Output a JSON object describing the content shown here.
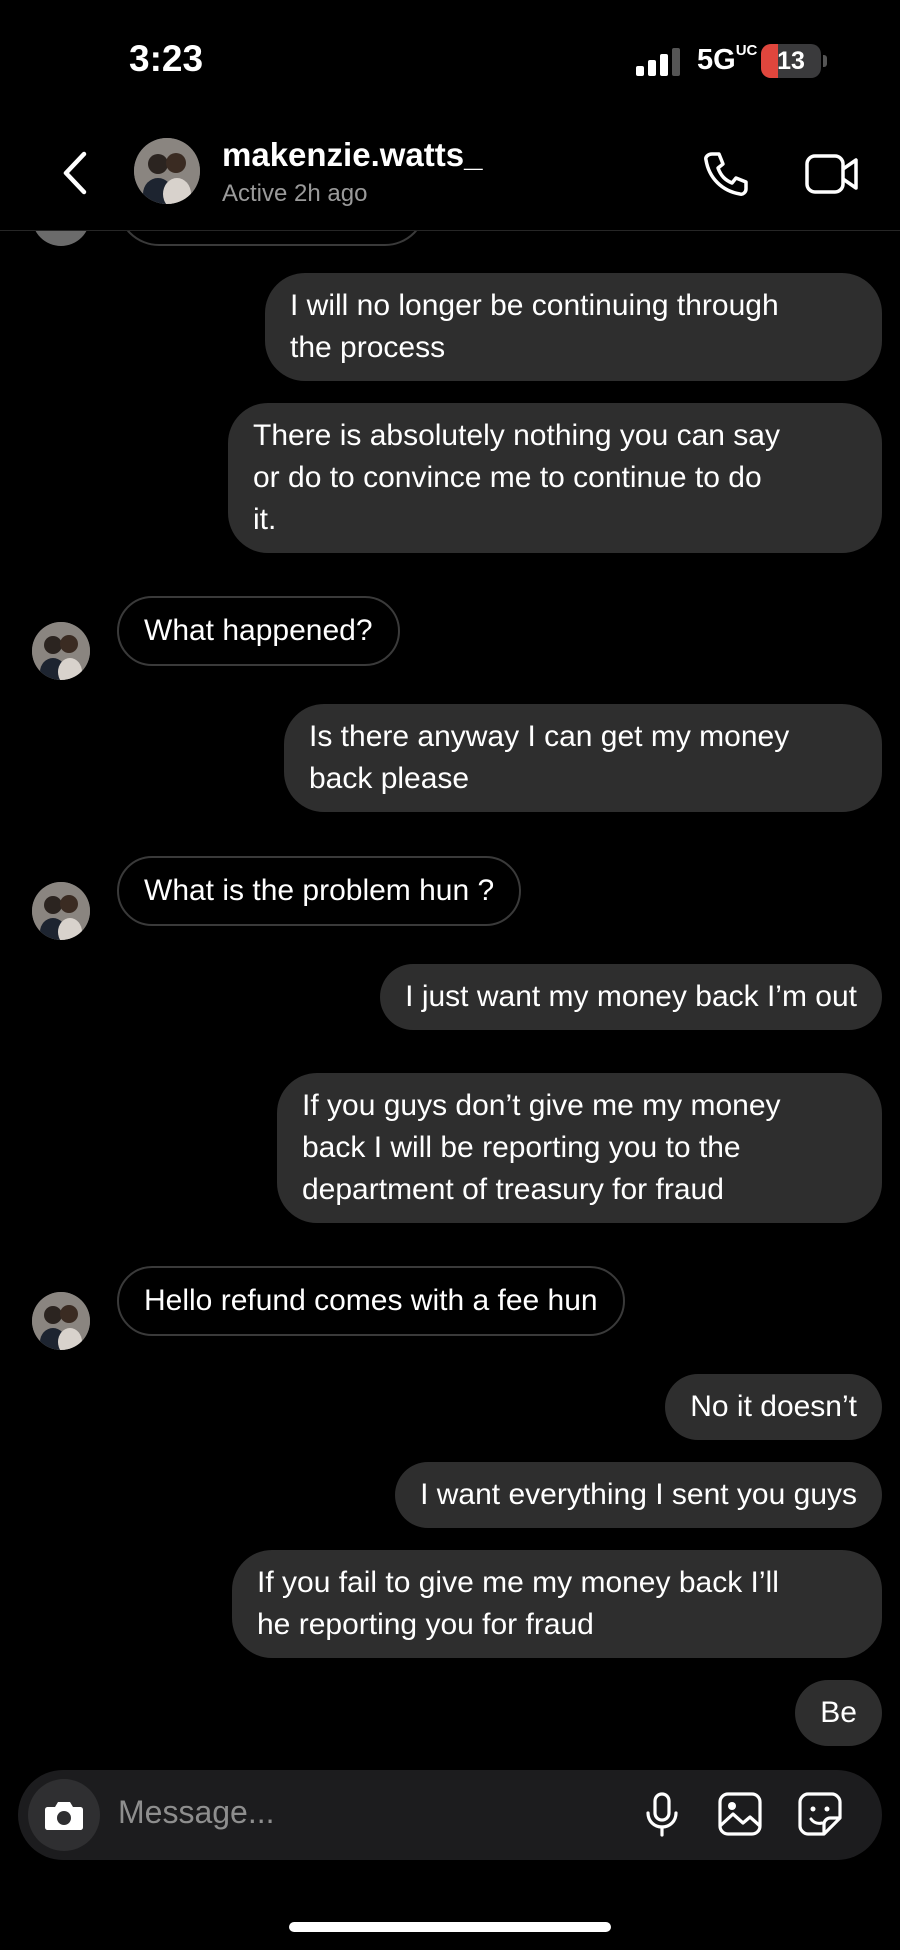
{
  "status_bar": {
    "time": "3:23",
    "network": "5G",
    "network_sup": "UC",
    "battery": "13",
    "battery_level": 0.13
  },
  "header": {
    "username": "makenzie.watts_",
    "status": "Active 2h ago"
  },
  "messages": [
    {
      "from": "me",
      "text": "I will no longer be continuing through\nthe process"
    },
    {
      "from": "me",
      "text": "There is absolutely nothing you can say\nor do to convince me to continue to do\nit."
    },
    {
      "from": "them",
      "text": "What happened?"
    },
    {
      "from": "me",
      "text": "Is there anyway I can get my money\nback please"
    },
    {
      "from": "them",
      "text": "What is the problem hun ?"
    },
    {
      "from": "me",
      "text": "I just want my money back I’m out"
    },
    {
      "from": "me",
      "text": "If you guys don’t give me my money\nback I will be reporting you to the\ndepartment of treasury for fraud"
    },
    {
      "from": "them",
      "text": "Hello refund comes with a fee hun"
    },
    {
      "from": "me",
      "text": "No it doesn’t"
    },
    {
      "from": "me",
      "text": "I want everything I sent you guys"
    },
    {
      "from": "me",
      "text": "If you fail to give me my money back I’ll\nhe reporting you for fraud"
    },
    {
      "from": "me",
      "text": "Be"
    }
  ],
  "composer": {
    "placeholder": "Message..."
  },
  "icons": [
    "back-icon",
    "phone-icon",
    "video-camera-icon",
    "camera-icon",
    "microphone-icon",
    "image-icon",
    "sticker-icon"
  ],
  "colors": {
    "outgoing_bubble": "#2e2e2e",
    "battery_low": "#e0463d"
  }
}
